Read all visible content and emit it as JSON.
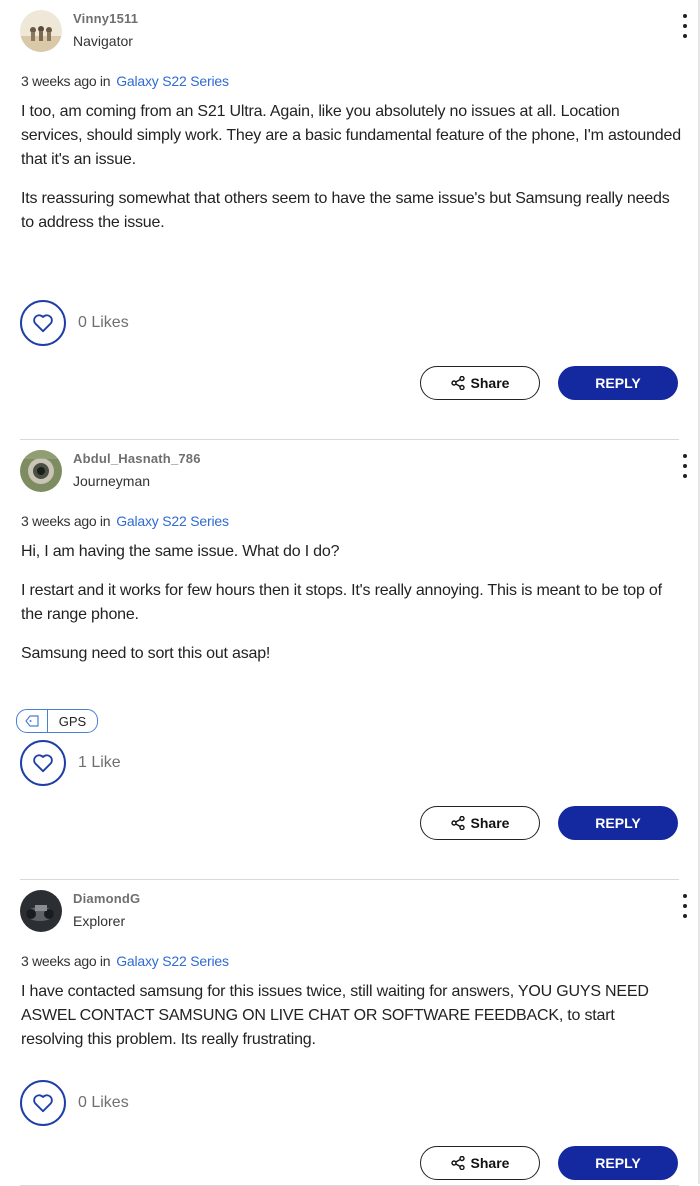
{
  "posts": [
    {
      "username": "Vinny1511",
      "rank": "Navigator",
      "time": "3 weeks ago in",
      "board": "Galaxy S22 Series",
      "paragraphs": [
        "I too, am coming from an S21 Ultra. Again, like you absolutely no issues at all. Location services, should simply work. They are a basic fundamental feature of the phone, I'm astounded that it's an issue.",
        "Its reassuring somewhat that others seem to have the same issue's but Samsung really needs to address the issue."
      ],
      "likes": "0 Likes",
      "share": "Share",
      "reply": "REPLY"
    },
    {
      "username": "Abdul_Hasnath_786",
      "rank": "Journeyman",
      "time": "3 weeks ago in",
      "board": "Galaxy S22 Series",
      "paragraphs": [
        "Hi, I am having the same issue. What do I do?",
        "I restart and it works for few hours then it stops.  It's really annoying. This is meant to be top of the range phone.",
        "Samsung need to sort this out asap!"
      ],
      "tag": "GPS",
      "likes": "1 Like",
      "share": "Share",
      "reply": "REPLY"
    },
    {
      "username": "DiamondG",
      "rank": "Explorer",
      "time": "3 weeks ago in",
      "board": "Galaxy S22 Series",
      "paragraphs": [
        "I have contacted samsung for this issues twice, still waiting for answers, YOU GUYS NEED ASWEL CONTACT SAMSUNG ON LIVE CHAT OR SOFTWARE FEEDBACK, to start resolving this problem. Its really frustrating."
      ],
      "likes": "0 Likes",
      "share": "Share",
      "reply": "REPLY"
    }
  ],
  "colors": {
    "brand_blue": "#1428a0",
    "link_blue": "#2f6bd0",
    "outline_blue": "#1e3fa8"
  },
  "icons": [
    "heart-icon",
    "share-icon",
    "kebab-menu-icon",
    "tag-icon"
  ]
}
